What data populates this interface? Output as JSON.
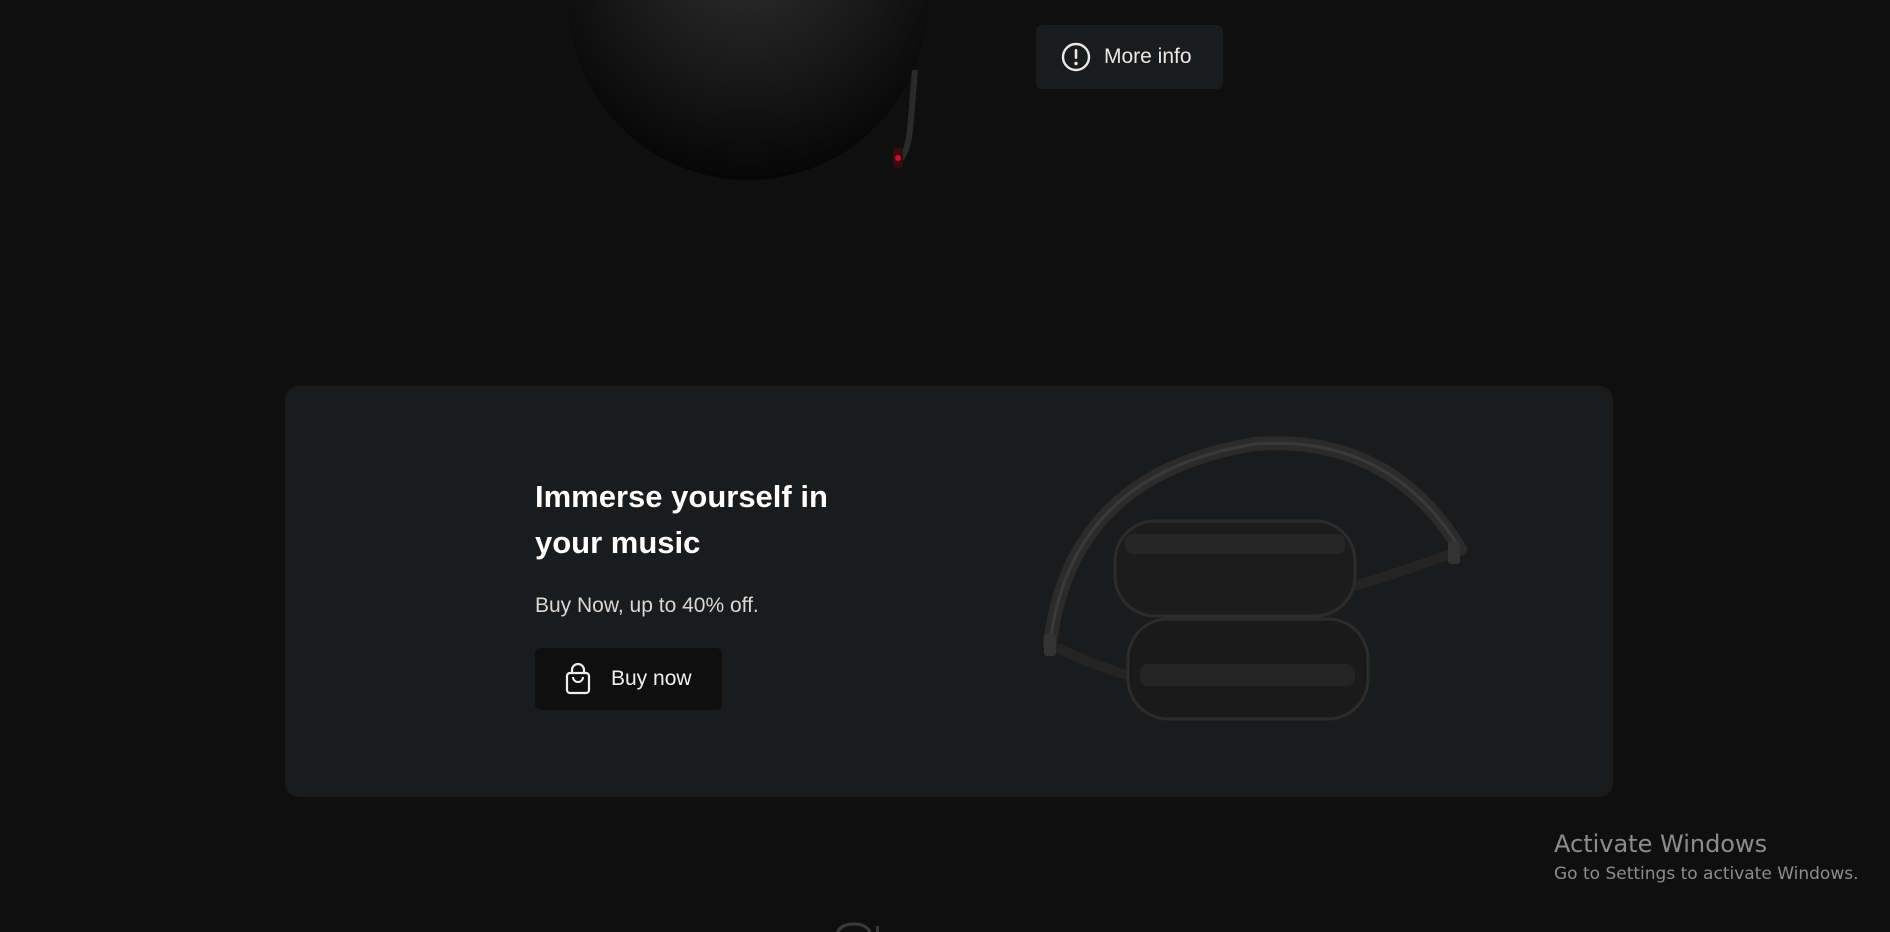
{
  "top_section": {
    "more_info_label": "More info",
    "icon": "info-circle-icon"
  },
  "banner": {
    "title": "Immerse yourself in your music",
    "subtitle": "Buy Now, up to 40% off.",
    "buy_label": "Buy now",
    "buy_icon": "shopping-bag-icon",
    "image": "headphones-image"
  },
  "watermark": {
    "title": "Activate Windows",
    "subtitle": "Go to Settings to activate Windows."
  },
  "colors": {
    "background": "#0f0f0f",
    "card": "#1a1b1d",
    "text": "#ffffff"
  }
}
